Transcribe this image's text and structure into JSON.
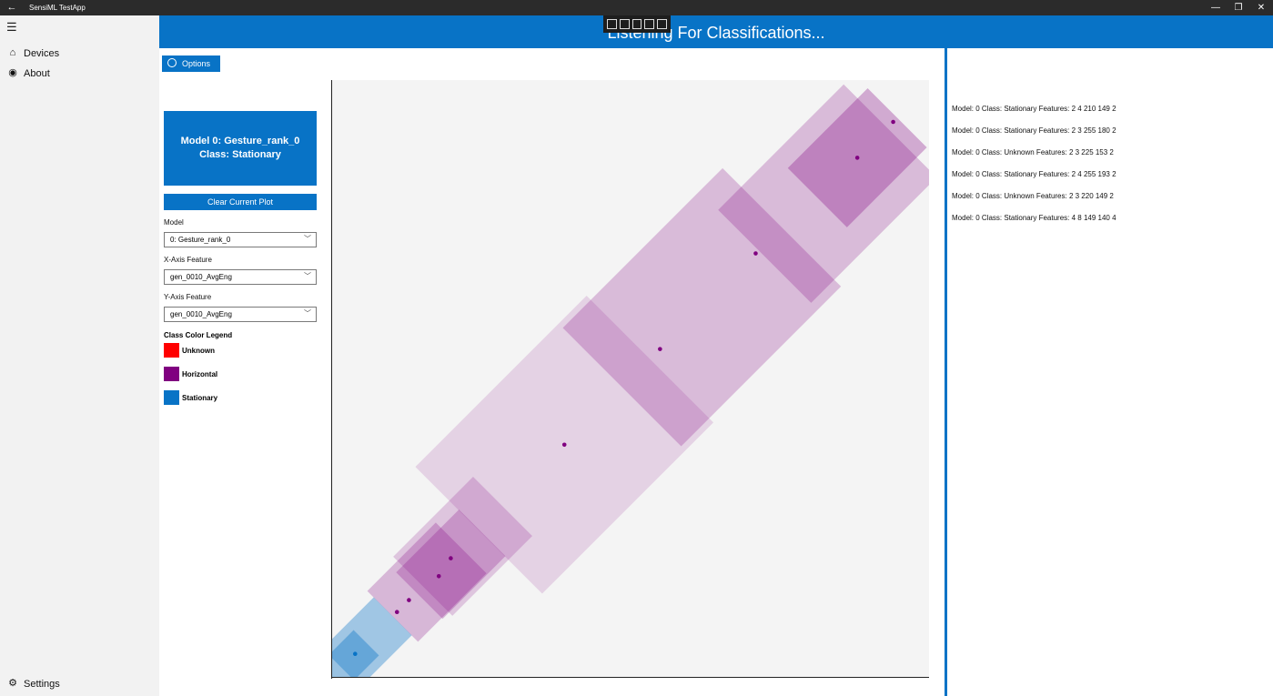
{
  "window": {
    "title": "SensiML TestApp",
    "back_icon": "back-arrow-icon",
    "minimize": "—",
    "maximize": "❐",
    "close": "✕"
  },
  "nav": {
    "menu_icon": "hamburger-icon",
    "items": [
      {
        "label": "Devices",
        "icon": "devices-icon"
      },
      {
        "label": "About",
        "icon": "about-icon"
      }
    ],
    "settings": {
      "label": "Settings",
      "icon": "gear-icon"
    }
  },
  "header": {
    "title": "Listening For Classifications..."
  },
  "controls": {
    "options_label": "Options",
    "status_line1": "Model 0: Gesture_rank_0",
    "status_line2": "Class: Stationary",
    "clear_label": "Clear Current Plot",
    "model_label": "Model",
    "model_value": "0: Gesture_rank_0",
    "x_label": "X-Axis Feature",
    "x_value": "gen_0010_AvgEng",
    "y_label": "Y-Axis Feature",
    "y_value": "gen_0010_AvgEng",
    "legend_title": "Class Color Legend",
    "legend": [
      {
        "label": "Unknown",
        "color": "#ff0000"
      },
      {
        "label": "Horizontal",
        "color": "#800080"
      },
      {
        "label": "Stationary",
        "color": "#0873c6"
      }
    ]
  },
  "colors": {
    "accent": "#0873c6",
    "horizontal": "#800080",
    "stationary": "#0873c6"
  },
  "chart_data": {
    "type": "scatter",
    "xlabel": "",
    "ylabel": "",
    "grid": false,
    "xlim": [
      0,
      100
    ],
    "ylim": [
      0,
      100
    ],
    "points": [
      {
        "x": 94,
        "y": 93,
        "class": "Horizontal"
      },
      {
        "x": 88,
        "y": 87,
        "class": "Horizontal"
      },
      {
        "x": 71,
        "y": 71,
        "class": "Horizontal"
      },
      {
        "x": 55,
        "y": 55,
        "class": "Horizontal"
      },
      {
        "x": 39,
        "y": 39,
        "class": "Horizontal"
      },
      {
        "x": 20,
        "y": 20,
        "class": "Horizontal"
      },
      {
        "x": 18,
        "y": 17,
        "class": "Horizontal"
      },
      {
        "x": 13,
        "y": 13,
        "class": "Horizontal"
      },
      {
        "x": 11,
        "y": 11,
        "class": "Horizontal"
      },
      {
        "x": 4,
        "y": 4,
        "class": "Stationary"
      }
    ],
    "regions": [
      {
        "cx": 88,
        "cy": 87,
        "size": 14,
        "class": "Horizontal",
        "opacity": 0.55
      },
      {
        "cx": 83,
        "cy": 81,
        "size": 22,
        "class": "Horizontal",
        "opacity": 0.42
      },
      {
        "cx": 62,
        "cy": 62,
        "size": 28,
        "class": "Horizontal",
        "opacity": 0.42
      },
      {
        "cx": 39,
        "cy": 39,
        "size": 30,
        "class": "Horizontal",
        "opacity": 0.25
      },
      {
        "cx": 22,
        "cy": 22,
        "size": 14,
        "class": "Horizontal",
        "opacity": 0.35
      },
      {
        "cx": 20,
        "cy": 19,
        "size": 11,
        "class": "Horizontal",
        "opacity": 0.45
      },
      {
        "cx": 16,
        "cy": 16,
        "size": 12,
        "class": "Horizontal",
        "opacity": 0.45
      },
      {
        "cx": 6,
        "cy": 6,
        "size": 9,
        "class": "Stationary",
        "opacity": 0.65
      },
      {
        "cx": 3,
        "cy": 3,
        "size": 6,
        "class": "Stationary",
        "opacity": 0.7
      }
    ]
  },
  "log": [
    "Model: 0 Class: Stationary Features: 2 4 210 149 2",
    "Model: 0 Class: Stationary Features: 2 3 255 180 2",
    "Model: 0 Class: Unknown Features: 2 3 225 153 2",
    "Model: 0 Class: Stationary Features: 2 4 255 193 2",
    "Model: 0 Class: Unknown Features: 2 3 220 149 2",
    "Model: 0 Class: Stationary Features: 4 8 149 140 4"
  ]
}
